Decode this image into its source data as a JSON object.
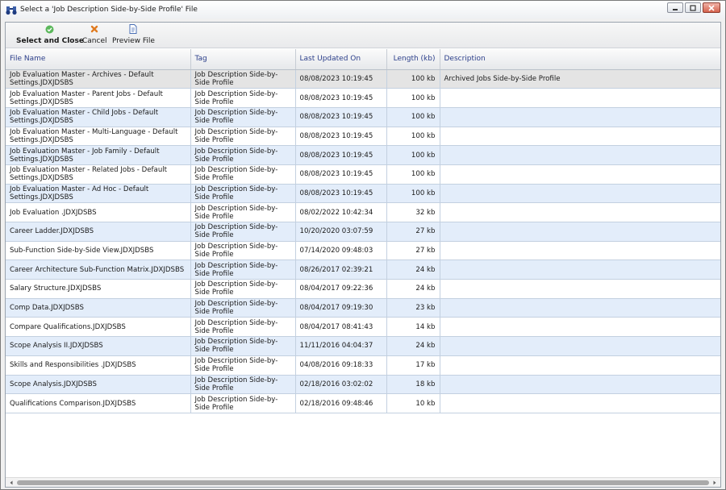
{
  "window": {
    "title": "Select a 'Job Description Side-by-Side Profile' File"
  },
  "toolbar": {
    "select_close_label": "Select and Close",
    "cancel_label": "Cancel",
    "preview_label": "Preview File"
  },
  "table": {
    "headers": {
      "file_name": "File Name",
      "tag": "Tag",
      "last_updated": "Last Updated On",
      "length": "Length (kb)",
      "description": "Description"
    },
    "rows": [
      {
        "file": "Job Evaluation Master - Archives - Default Settings.JDXJDSBS",
        "tag": "Job Description Side-by-Side Profile",
        "updated": "08/08/2023 10:19:45",
        "length": "100 kb",
        "description": "Archived Jobs Side-by-Side Profile"
      },
      {
        "file": "Job Evaluation Master - Parent Jobs - Default Settings.JDXJDSBS",
        "tag": "Job Description Side-by-Side Profile",
        "updated": "08/08/2023 10:19:45",
        "length": "100 kb",
        "description": ""
      },
      {
        "file": "Job Evaluation Master - Child Jobs - Default Settings.JDXJDSBS",
        "tag": "Job Description Side-by-Side Profile",
        "updated": "08/08/2023 10:19:45",
        "length": "100 kb",
        "description": ""
      },
      {
        "file": "Job Evaluation Master - Multi-Language - Default Settings.JDXJDSBS",
        "tag": "Job Description Side-by-Side Profile",
        "updated": "08/08/2023 10:19:45",
        "length": "100 kb",
        "description": ""
      },
      {
        "file": "Job Evaluation Master - Job Family - Default Settings.JDXJDSBS",
        "tag": "Job Description Side-by-Side Profile",
        "updated": "08/08/2023 10:19:45",
        "length": "100 kb",
        "description": ""
      },
      {
        "file": "Job Evaluation Master - Related Jobs - Default Settings.JDXJDSBS",
        "tag": "Job Description Side-by-Side Profile",
        "updated": "08/08/2023 10:19:45",
        "length": "100 kb",
        "description": ""
      },
      {
        "file": "Job Evaluation Master - Ad Hoc  - Default Settings.JDXJDSBS",
        "tag": "Job Description Side-by-Side Profile",
        "updated": "08/08/2023 10:19:45",
        "length": "100 kb",
        "description": ""
      },
      {
        "file": "Job Evaluation .JDXJDSBS",
        "tag": "Job Description Side-by-Side Profile",
        "updated": "08/02/2022 10:42:34",
        "length": "32 kb",
        "description": ""
      },
      {
        "file": "Career Ladder.JDXJDSBS",
        "tag": "Job Description Side-by-Side Profile",
        "updated": "10/20/2020 03:07:59",
        "length": "27 kb",
        "description": ""
      },
      {
        "file": "Sub-Function Side-by-Side View.JDXJDSBS",
        "tag": "Job Description Side-by-Side Profile",
        "updated": "07/14/2020 09:48:03",
        "length": "27 kb",
        "description": ""
      },
      {
        "file": "Career Architecture Sub-Function Matrix.JDXJDSBS",
        "tag": "Job Description Side-by-Side Profile",
        "updated": "08/26/2017 02:39:21",
        "length": "24 kb",
        "description": ""
      },
      {
        "file": "Salary Structure.JDXJDSBS",
        "tag": "Job Description Side-by-Side Profile",
        "updated": "08/04/2017 09:22:36",
        "length": "24 kb",
        "description": ""
      },
      {
        "file": "Comp Data.JDXJDSBS",
        "tag": "Job Description Side-by-Side Profile",
        "updated": "08/04/2017 09:19:30",
        "length": "23 kb",
        "description": ""
      },
      {
        "file": "Compare Qualifications.JDXJDSBS",
        "tag": "Job Description Side-by-Side Profile",
        "updated": "08/04/2017 08:41:43",
        "length": "14 kb",
        "description": ""
      },
      {
        "file": "Scope Analysis II.JDXJDSBS",
        "tag": "Job Description Side-by-Side Profile",
        "updated": "11/11/2016 04:04:37",
        "length": "24 kb",
        "description": ""
      },
      {
        "file": "Skills and Responsibilities .JDXJDSBS",
        "tag": "Job Description Side-by-Side Profile",
        "updated": "04/08/2016 09:18:33",
        "length": "17 kb",
        "description": ""
      },
      {
        "file": "Scope Analysis.JDXJDSBS",
        "tag": "Job Description Side-by-Side Profile",
        "updated": "02/18/2016 03:02:02",
        "length": "18 kb",
        "description": ""
      },
      {
        "file": "Qualifications Comparison.JDXJDSBS",
        "tag": "Job Description Side-by-Side Profile",
        "updated": "02/18/2016 09:48:46",
        "length": "10 kb",
        "description": ""
      }
    ]
  },
  "colors": {
    "header_text": "#2c3f8a",
    "alt_row": "#e3edfa",
    "selected_row": "#e4e4e4",
    "select_icon": "#5cb85c",
    "cancel_icon": "#e07b20"
  },
  "icons": {
    "app": "binoculars-icon",
    "select": "check-circle-icon",
    "cancel": "x-icon",
    "preview": "document-preview-icon"
  }
}
